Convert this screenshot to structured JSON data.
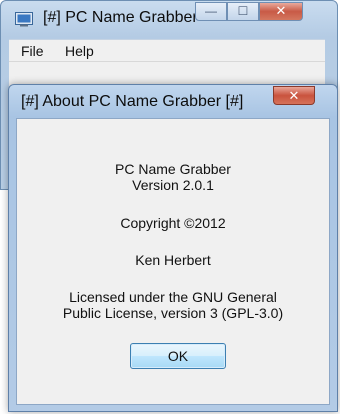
{
  "main_window": {
    "title": "[#] PC Name Grabber",
    "caption": {
      "minimize": "—",
      "maximize": "☐",
      "close": "✕"
    },
    "menu": [
      "File",
      "Help"
    ]
  },
  "dialog": {
    "title": "[#] About PC Name Grabber [#]",
    "close_glyph": "✕",
    "app_name": "PC Name Grabber",
    "version": "Version 2.0.1",
    "copyright": "Copyright ©2012",
    "author": "Ken Herbert",
    "license_line1": "Licensed under the GNU General",
    "license_line2": "Public License, version 3 (GPL-3.0)",
    "ok_label": "OK"
  },
  "colors": {
    "titlebar_blue": "#b9cfe6",
    "close_red": "#c9533e",
    "ok_border": "#3c7fb1"
  },
  "icons": {
    "app": "computer-window-icon"
  }
}
